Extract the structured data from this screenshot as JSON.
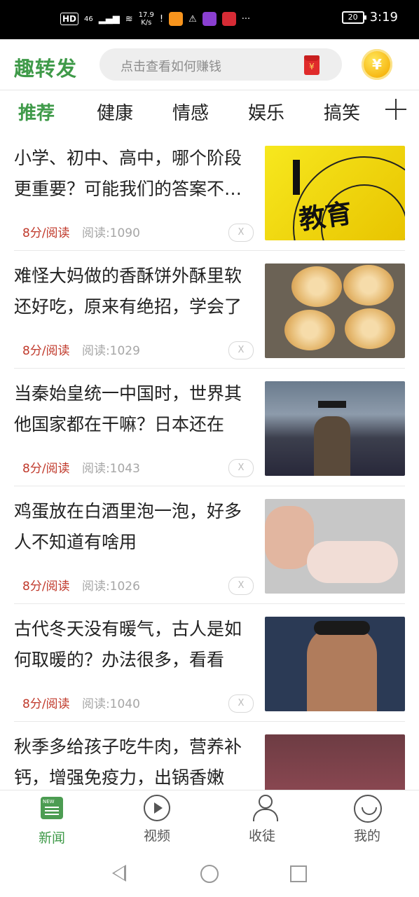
{
  "statusbar": {
    "hd": "HD",
    "network": "46",
    "speed_value": "17.9",
    "speed_unit": "K/s",
    "more": "···",
    "battery": "20",
    "time": "3:19"
  },
  "header": {
    "logo": "趣转发",
    "search_placeholder": "点击查看如何赚钱",
    "coin_symbol": "¥",
    "redpacket_symbol": "¥"
  },
  "tabs": [
    "推荐",
    "健康",
    "情感",
    "娱乐",
    "搞笑"
  ],
  "articles": [
    {
      "title": "小学、初中、高中，哪个阶段更重要？可能我们的答案不一样",
      "score": "8分/阅读",
      "reads": "阅读:1090",
      "dismiss": "X"
    },
    {
      "title": "难怪大妈做的香酥饼外酥里软还好吃，原来有绝招，学会了",
      "score": "8分/阅读",
      "reads": "阅读:1029",
      "dismiss": "X"
    },
    {
      "title": "当秦始皇统一中国时，世界其他国家都在干嘛？日本还在",
      "score": "8分/阅读",
      "reads": "阅读:1043",
      "dismiss": "X"
    },
    {
      "title": "鸡蛋放在白酒里泡一泡，好多人不知道有啥用",
      "score": "8分/阅读",
      "reads": "阅读:1026",
      "dismiss": "X"
    },
    {
      "title": "古代冬天没有暖气，古人是如何取暖的？办法很多，看看",
      "score": "8分/阅读",
      "reads": "阅读:1040",
      "dismiss": "X"
    },
    {
      "title": "秋季多给孩子吃牛肉，营养补钙，增强免疫力，出锅香嫩",
      "score": "",
      "reads": "",
      "dismiss": ""
    }
  ],
  "thumbnail_icons": [
    "education-target-image",
    "pastry-image",
    "army-emperor-image",
    "egg-image",
    "ancient-drama-image",
    "beef-image"
  ],
  "bottom_nav": [
    {
      "label": "新闻",
      "icon": "news-icon",
      "active": true
    },
    {
      "label": "视频",
      "icon": "video-play-icon",
      "active": false
    },
    {
      "label": "收徒",
      "icon": "users-icon",
      "active": false
    },
    {
      "label": "我的",
      "icon": "smile-profile-icon",
      "active": false
    }
  ],
  "colors": {
    "brand_green": "#3f9a49",
    "score_red": "#c0392b",
    "reads_gray": "#a6a6a6",
    "coin_gold": "#f6b40e"
  }
}
